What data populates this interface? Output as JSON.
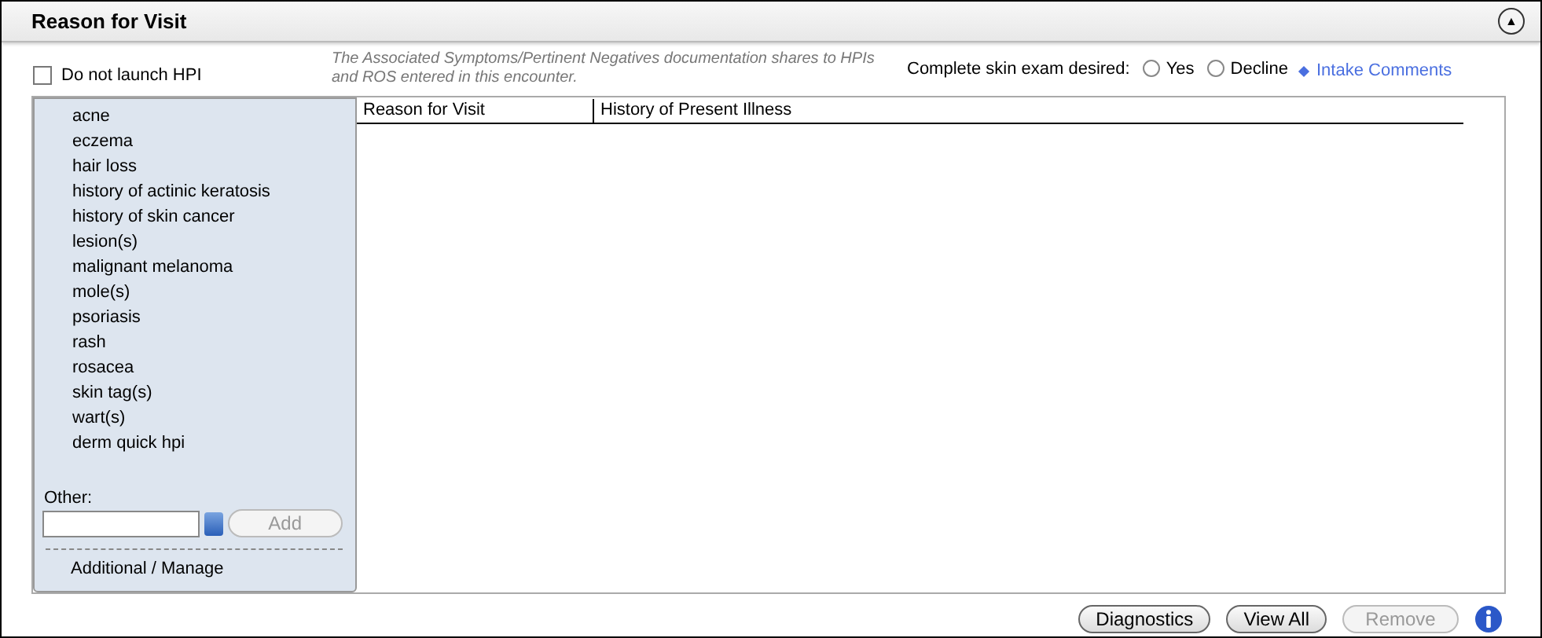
{
  "title": "Reason for Visit",
  "collapse_button": {
    "label": "▲"
  },
  "do_not_launch_hpi": {
    "label": "Do not launch HPI",
    "checked": false
  },
  "note": "The Associated Symptoms/Pertinent Negatives documentation shares to HPIs and ROS entered in this encounter.",
  "skin_exam": {
    "label": "Complete skin exam desired:",
    "options": [
      {
        "label": "Yes",
        "selected": false
      },
      {
        "label": "Decline",
        "selected": false
      }
    ]
  },
  "intake_link": "Intake Comments",
  "reasons": [
    "acne",
    "eczema",
    "hair loss",
    "history of actinic keratosis",
    "history of skin cancer",
    "lesion(s)",
    "malignant melanoma",
    "mole(s)",
    "psoriasis",
    "rash",
    "rosacea",
    "skin tag(s)",
    "wart(s)",
    "derm quick hpi"
  ],
  "other": {
    "label": "Other:",
    "add_button": {
      "label": "Add",
      "disabled": true
    }
  },
  "additional_manage": "Additional / Manage",
  "table": {
    "columns": [
      "Reason for Visit",
      "History of Present Illness"
    ]
  },
  "buttons": [
    {
      "label": "Diagnostics",
      "disabled": false
    },
    {
      "label": "View All",
      "disabled": false
    },
    {
      "label": "Remove",
      "disabled": true
    }
  ]
}
